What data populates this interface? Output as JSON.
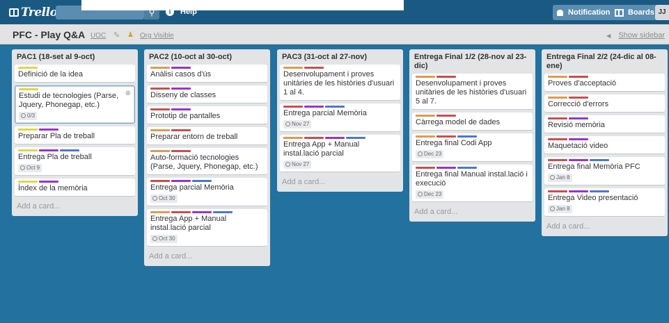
{
  "topbar": {
    "logo": "Trello",
    "help": "Help",
    "notifications": "Notifications",
    "boards": "Boards",
    "avatar_initials": "JJ"
  },
  "header": {
    "board_name": "PFC - Play Q&A",
    "org": "UOC",
    "visibility": "Org Visible",
    "show_sidebar": "Show sidebar"
  },
  "label_colors": {
    "yellow": "#e0d64c",
    "purple": "#9933cc",
    "red": "#cb4d4d",
    "orange": "#e09952",
    "blue": "#4d77cb"
  },
  "lists": [
    {
      "title": "PAC1 (18-set al 9-oct)",
      "add_card": "Add a card...",
      "cards": [
        {
          "labels": [
            "yellow"
          ],
          "text": "Definició de la idea"
        },
        {
          "labels": [
            "yellow"
          ],
          "text": "Estudi de tecnologies (Parse, Jquery, Phonegap, etc.)",
          "badge": "0/3",
          "selected": true
        },
        {
          "labels": [
            "yellow",
            "purple"
          ],
          "text": "Preparar Pla de treball"
        },
        {
          "labels": [
            "yellow",
            "purple",
            "blue"
          ],
          "text": "Entrega Pla de treball",
          "badge": "Oct 9"
        },
        {
          "labels": [
            "yellow",
            "purple"
          ],
          "text": "Índex de la memòria"
        }
      ]
    },
    {
      "title": "PAC2 (10-oct al 30-oct)",
      "add_card": "Add a card...",
      "cards": [
        {
          "labels": [
            "orange",
            "purple"
          ],
          "text": "Anàlisi casos d'ús"
        },
        {
          "labels": [
            "red",
            "purple"
          ],
          "text": "Disseny de classes"
        },
        {
          "labels": [
            "red",
            "purple"
          ],
          "text": "Prototip de pantalles"
        },
        {
          "labels": [
            "orange",
            "red"
          ],
          "text": "Preparar entorn de treball"
        },
        {
          "labels": [
            "orange",
            "red"
          ],
          "text": "Auto-formació tecnologies (Parse, Jquery, Phonegap, etc.)"
        },
        {
          "labels": [
            "red",
            "purple",
            "blue"
          ],
          "text": "Entrega parcial Memòria",
          "badge": "Oct 30"
        },
        {
          "labels": [
            "orange",
            "red",
            "purple",
            "blue"
          ],
          "text": "Entrega App + Manual instal.lació parcial",
          "badge": "Oct 30"
        }
      ]
    },
    {
      "title": "PAC3 (31-oct al 27-nov)",
      "add_card": "Add a card...",
      "cards": [
        {
          "labels": [
            "orange",
            "red"
          ],
          "text": "Desenvolupament i proves unitàries de les històries d'usuari 1 al 4."
        },
        {
          "labels": [
            "red",
            "purple",
            "blue"
          ],
          "text": "Entrega parcial Memòria",
          "badge": "Nov 27"
        },
        {
          "labels": [
            "orange",
            "red",
            "purple",
            "blue"
          ],
          "text": "Entrega App + Manual instal.lació parcial",
          "badge": "Nov 27"
        }
      ]
    },
    {
      "title": "Entrega Final 1/2 (28-nov al 23-dic)",
      "add_card": "Add a card...",
      "cards": [
        {
          "labels": [
            "orange",
            "red"
          ],
          "text": "Desenvolupament i proves unitàries de les històries d'usuari 5 al 7."
        },
        {
          "labels": [
            "orange",
            "red"
          ],
          "text": "Càrrega model de dades"
        },
        {
          "labels": [
            "orange",
            "red",
            "blue"
          ],
          "text": "Entrega final Codi App",
          "badge": "Dec 23"
        },
        {
          "labels": [
            "red",
            "purple",
            "blue"
          ],
          "text": "Entrega final Manual instal.lació i execució",
          "badge": "Dec 23"
        }
      ]
    },
    {
      "title": "Entrega Final 2/2 (24-dic al 08-ene)",
      "add_card": "Add a card...",
      "cards": [
        {
          "labels": [
            "orange",
            "red"
          ],
          "text": "Proves d'acceptació"
        },
        {
          "labels": [
            "orange",
            "red"
          ],
          "text": "Correcció d'errors"
        },
        {
          "labels": [
            "red",
            "purple"
          ],
          "text": "Revisió memòria"
        },
        {
          "labels": [
            "red",
            "purple"
          ],
          "text": "Maquetació video"
        },
        {
          "labels": [
            "red",
            "purple",
            "blue"
          ],
          "text": "Entrega final Memòria PFC",
          "badge": "Jan 8"
        },
        {
          "labels": [
            "red",
            "purple",
            "blue"
          ],
          "text": "Entrega Video presentació",
          "badge": "Jan 8"
        }
      ]
    }
  ]
}
